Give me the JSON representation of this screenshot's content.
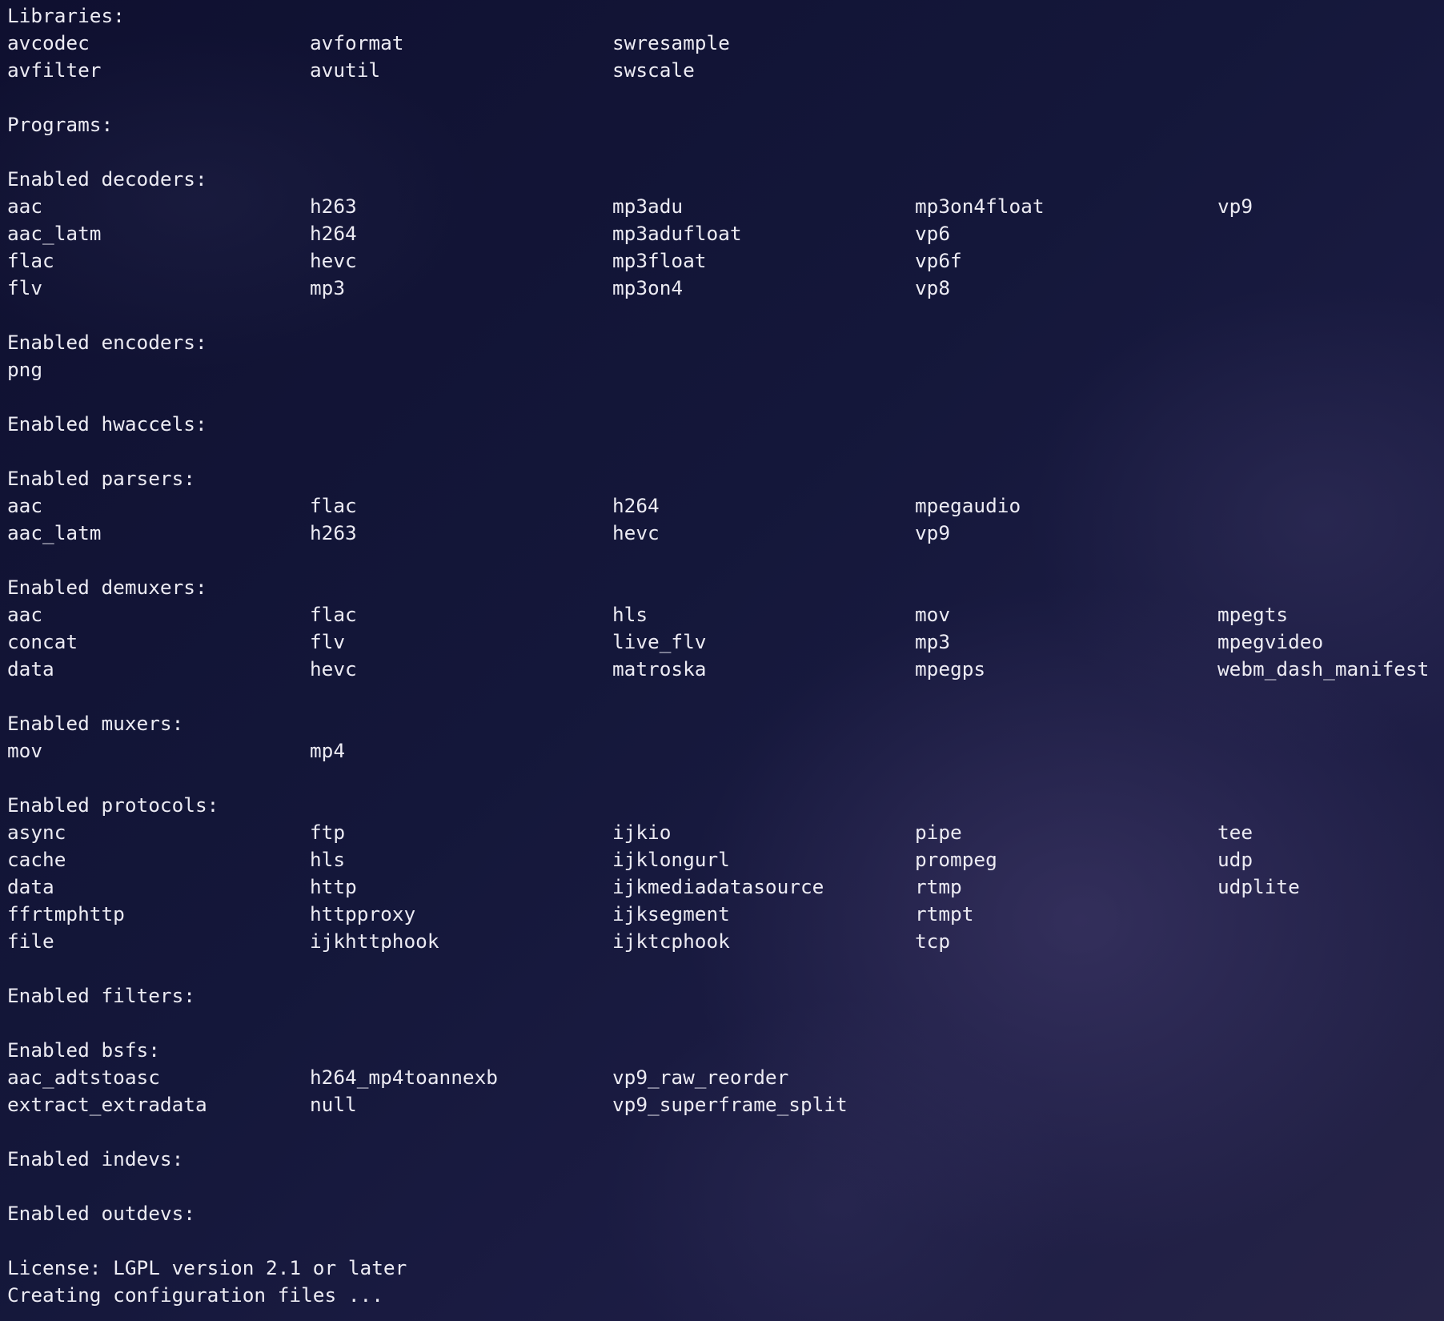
{
  "terminal": {
    "sections": [
      {
        "heading": "Libraries:",
        "rows": [
          [
            "avcodec",
            "avformat",
            "swresample"
          ],
          [
            "avfilter",
            "avutil",
            "swscale"
          ]
        ]
      },
      {
        "heading": "Programs:",
        "rows": []
      },
      {
        "heading": "Enabled decoders:",
        "rows": [
          [
            "aac",
            "h263",
            "mp3adu",
            "mp3on4float",
            "vp9"
          ],
          [
            "aac_latm",
            "h264",
            "mp3adufloat",
            "vp6"
          ],
          [
            "flac",
            "hevc",
            "mp3float",
            "vp6f"
          ],
          [
            "flv",
            "mp3",
            "mp3on4",
            "vp8"
          ]
        ]
      },
      {
        "heading": "Enabled encoders:",
        "rows": [
          [
            "png"
          ]
        ]
      },
      {
        "heading": "Enabled hwaccels:",
        "rows": []
      },
      {
        "heading": "Enabled parsers:",
        "rows": [
          [
            "aac",
            "flac",
            "h264",
            "mpegaudio"
          ],
          [
            "aac_latm",
            "h263",
            "hevc",
            "vp9"
          ]
        ]
      },
      {
        "heading": "Enabled demuxers:",
        "rows": [
          [
            "aac",
            "flac",
            "hls",
            "mov",
            "mpegts"
          ],
          [
            "concat",
            "flv",
            "live_flv",
            "mp3",
            "mpegvideo"
          ],
          [
            "data",
            "hevc",
            "matroska",
            "mpegps",
            "webm_dash_manifest"
          ]
        ]
      },
      {
        "heading": "Enabled muxers:",
        "rows": [
          [
            "mov",
            "mp4"
          ]
        ]
      },
      {
        "heading": "Enabled protocols:",
        "rows": [
          [
            "async",
            "ftp",
            "ijkio",
            "pipe",
            "tee"
          ],
          [
            "cache",
            "hls",
            "ijklongurl",
            "prompeg",
            "udp"
          ],
          [
            "data",
            "http",
            "ijkmediadatasource",
            "rtmp",
            "udplite"
          ],
          [
            "ffrtmphttp",
            "httpproxy",
            "ijksegment",
            "rtmpt"
          ],
          [
            "file",
            "ijkhttphook",
            "ijktcphook",
            "tcp"
          ]
        ]
      },
      {
        "heading": "Enabled filters:",
        "rows": []
      },
      {
        "heading": "Enabled bsfs:",
        "rows": [
          [
            "aac_adtstoasc",
            "h264_mp4toannexb",
            "vp9_raw_reorder"
          ],
          [
            "extract_extradata",
            "null",
            "vp9_superframe_split"
          ]
        ]
      },
      {
        "heading": "Enabled indevs:",
        "rows": []
      },
      {
        "heading": "Enabled outdevs:",
        "rows": []
      }
    ],
    "footer": [
      "License: LGPL version 2.1 or later",
      "Creating configuration files ..."
    ]
  }
}
